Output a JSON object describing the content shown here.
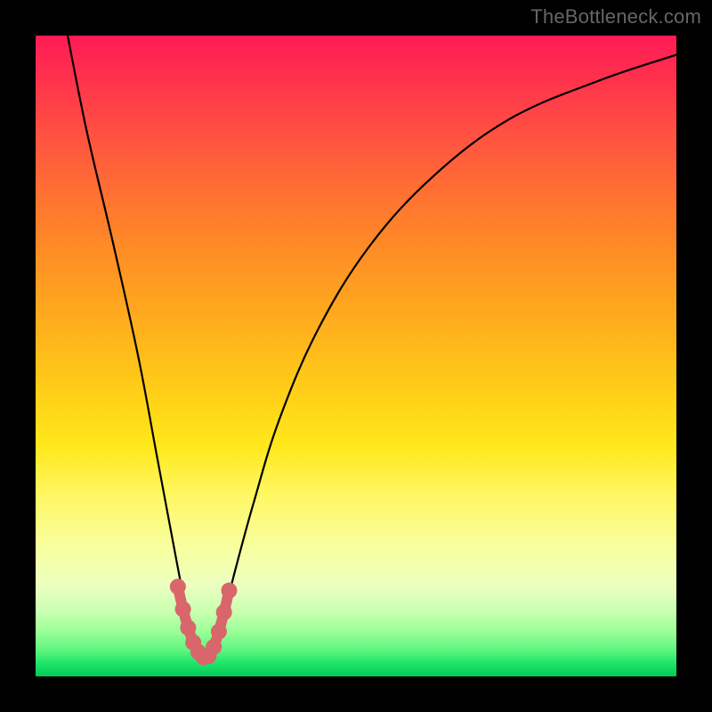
{
  "watermark": "TheBottleneck.com",
  "chart_data": {
    "type": "line",
    "title": "",
    "xlabel": "",
    "ylabel": "",
    "xlim": [
      0,
      100
    ],
    "ylim": [
      0,
      100
    ],
    "series": [
      {
        "name": "curve",
        "color": "#000000",
        "x": [
          5,
          8,
          12,
          16,
          19,
          22,
          24,
          25.5,
          27,
          29,
          31,
          34,
          38,
          44,
          52,
          62,
          74,
          88,
          100
        ],
        "y": [
          100,
          85,
          68,
          50,
          34,
          18,
          8,
          3,
          3,
          8,
          16,
          27,
          40,
          54,
          67,
          78,
          87,
          93,
          97
        ]
      },
      {
        "name": "highlight",
        "color": "#d9666b",
        "x": [
          22.2,
          23.0,
          23.8,
          24.6,
          25.4,
          26.2,
          27.0,
          27.8,
          28.6,
          29.4,
          30.2
        ],
        "y": [
          14.0,
          10.5,
          7.6,
          5.3,
          3.8,
          3.0,
          3.2,
          4.6,
          7.0,
          10.0,
          13.4
        ]
      }
    ]
  },
  "colors": {
    "curve": "#000000",
    "highlight_stroke": "#d9666b",
    "highlight_dot": "#d9666b",
    "background_black": "#000000"
  }
}
